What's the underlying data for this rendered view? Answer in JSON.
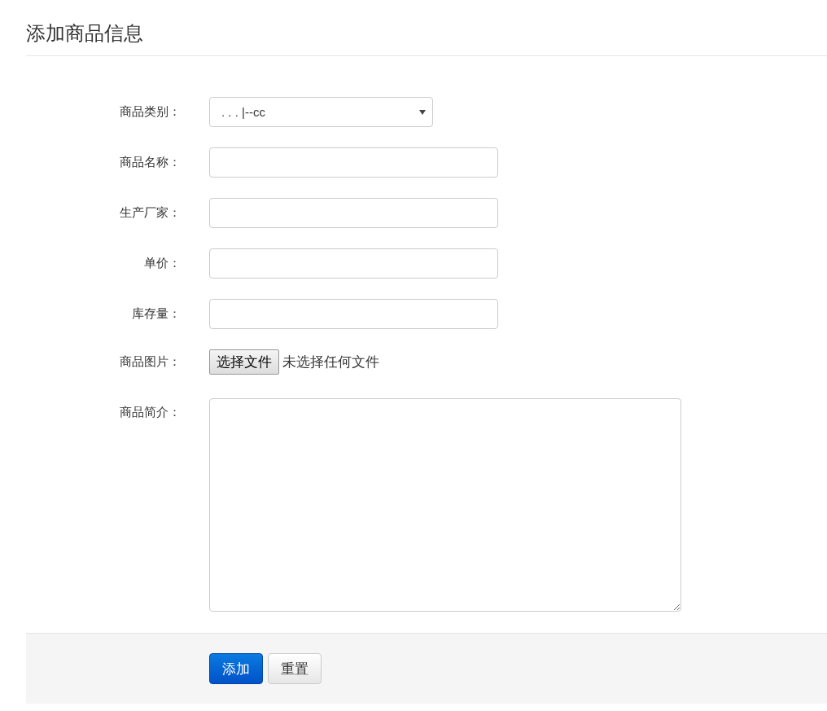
{
  "title": "添加商品信息",
  "fields": [
    {
      "kind": "select",
      "label": "商品类别：",
      "value": ". . . |--cc"
    },
    {
      "kind": "text",
      "label": "商品名称："
    },
    {
      "kind": "text",
      "label": "生产厂家："
    },
    {
      "kind": "text",
      "label": "单价："
    },
    {
      "kind": "text",
      "label": "库存量："
    },
    {
      "kind": "file",
      "label": "商品图片：",
      "button": "选择文件",
      "status": "未选择任何文件"
    },
    {
      "kind": "textarea",
      "label": "商品简介："
    }
  ],
  "buttons": [
    {
      "label": "添加",
      "kind": "primary"
    },
    {
      "label": "重置",
      "kind": "default"
    }
  ]
}
